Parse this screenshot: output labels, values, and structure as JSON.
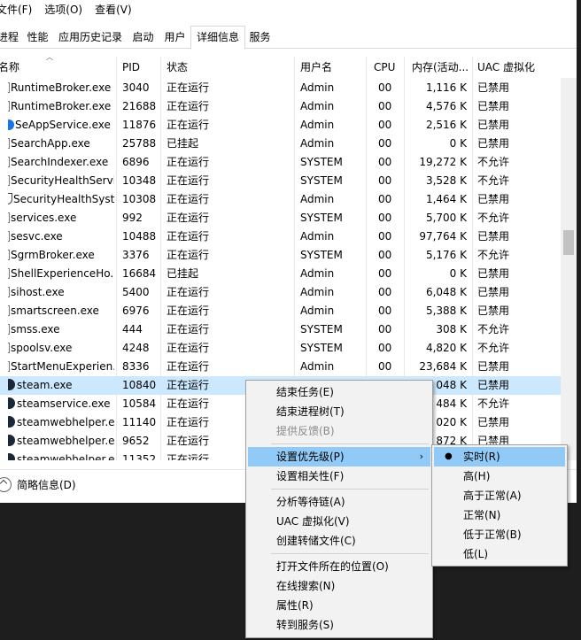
{
  "menubar": [
    "文件(F)",
    "选项(O)",
    "查看(V)"
  ],
  "tabs": [
    {
      "label": "进程",
      "active": false
    },
    {
      "label": "性能",
      "active": false
    },
    {
      "label": "应用历史记录",
      "active": false
    },
    {
      "label": "启动",
      "active": false
    },
    {
      "label": "用户",
      "active": false
    },
    {
      "label": "详细信息",
      "active": true
    },
    {
      "label": "服务",
      "active": false
    }
  ],
  "columns": [
    "名称",
    "PID",
    "状态",
    "用户名",
    "CPU",
    "内存(活动...",
    "UAC 虚拟化"
  ],
  "rows": [
    {
      "name": "RuntimeBroker.exe",
      "pid": "3040",
      "status": "正在运行",
      "user": "Admin",
      "cpu": "00",
      "mem": "1,116 K",
      "uac": "已禁用",
      "icon": "doc"
    },
    {
      "name": "RuntimeBroker.exe",
      "pid": "21688",
      "status": "正在运行",
      "user": "Admin",
      "cpu": "00",
      "mem": "4,576 K",
      "uac": "已禁用",
      "icon": "doc"
    },
    {
      "name": "SeAppService.exe",
      "pid": "11876",
      "status": "正在运行",
      "user": "Admin",
      "cpu": "00",
      "mem": "2,516 K",
      "uac": "已禁用",
      "icon": "blue"
    },
    {
      "name": "SearchApp.exe",
      "pid": "25788",
      "status": "已挂起",
      "user": "Admin",
      "cpu": "00",
      "mem": "0 K",
      "uac": "已禁用",
      "icon": "doc"
    },
    {
      "name": "SearchIndexer.exe",
      "pid": "6896",
      "status": "正在运行",
      "user": "SYSTEM",
      "cpu": "00",
      "mem": "19,272 K",
      "uac": "不允许",
      "icon": "doc"
    },
    {
      "name": "SecurityHealthServi...",
      "pid": "10348",
      "status": "正在运行",
      "user": "SYSTEM",
      "cpu": "00",
      "mem": "3,528 K",
      "uac": "不允许",
      "icon": "doc"
    },
    {
      "name": "SecurityHealthSystr...",
      "pid": "10308",
      "status": "正在运行",
      "user": "Admin",
      "cpu": "00",
      "mem": "1,464 K",
      "uac": "已禁用",
      "icon": "shield"
    },
    {
      "name": "services.exe",
      "pid": "992",
      "status": "正在运行",
      "user": "SYSTEM",
      "cpu": "00",
      "mem": "5,700 K",
      "uac": "不允许",
      "icon": "doc"
    },
    {
      "name": "sesvc.exe",
      "pid": "10488",
      "status": "正在运行",
      "user": "Admin",
      "cpu": "00",
      "mem": "97,764 K",
      "uac": "已禁用",
      "icon": "doc"
    },
    {
      "name": "SgrmBroker.exe",
      "pid": "3376",
      "status": "正在运行",
      "user": "SYSTEM",
      "cpu": "00",
      "mem": "5,176 K",
      "uac": "不允许",
      "icon": "doc"
    },
    {
      "name": "ShellExperienceHo...",
      "pid": "16684",
      "status": "已挂起",
      "user": "Admin",
      "cpu": "00",
      "mem": "0 K",
      "uac": "已禁用",
      "icon": "doc"
    },
    {
      "name": "sihost.exe",
      "pid": "5400",
      "status": "正在运行",
      "user": "Admin",
      "cpu": "00",
      "mem": "6,048 K",
      "uac": "已禁用",
      "icon": "doc"
    },
    {
      "name": "smartscreen.exe",
      "pid": "6976",
      "status": "正在运行",
      "user": "Admin",
      "cpu": "00",
      "mem": "5,388 K",
      "uac": "已禁用",
      "icon": "doc"
    },
    {
      "name": "smss.exe",
      "pid": "444",
      "status": "正在运行",
      "user": "SYSTEM",
      "cpu": "00",
      "mem": "308 K",
      "uac": "不允许",
      "icon": "doc"
    },
    {
      "name": "spoolsv.exe",
      "pid": "4248",
      "status": "正在运行",
      "user": "SYSTEM",
      "cpu": "00",
      "mem": "4,820 K",
      "uac": "不允许",
      "icon": "doc"
    },
    {
      "name": "StartMenuExperien...",
      "pid": "8336",
      "status": "正在运行",
      "user": "Admin",
      "cpu": "00",
      "mem": "23,684 K",
      "uac": "已禁用",
      "icon": "doc"
    },
    {
      "name": "steam.exe",
      "pid": "10840",
      "status": "正在运行",
      "user": "",
      "cpu": "",
      "mem": "048 K",
      "uac": "已禁用",
      "icon": "steam",
      "selected": true
    },
    {
      "name": "steamservice.exe",
      "pid": "10584",
      "status": "正在运行",
      "user": "",
      "cpu": "",
      "mem": "484 K",
      "uac": "不允许",
      "icon": "steam"
    },
    {
      "name": "steamwebhelper.exe",
      "pid": "11140",
      "status": "正在运行",
      "user": "",
      "cpu": "",
      "mem": "020 K",
      "uac": "已禁用",
      "icon": "steam"
    },
    {
      "name": "steamwebhelper.exe",
      "pid": "9652",
      "status": "正在运行",
      "user": "",
      "cpu": "",
      "mem": "872 K",
      "uac": "已禁用",
      "icon": "steam"
    },
    {
      "name": "steamwebhelper.exe",
      "pid": "11352",
      "status": "正在运行",
      "user": "",
      "cpu": "",
      "mem": "",
      "uac": "",
      "icon": "steam"
    }
  ],
  "footer": {
    "label": "简略信息(D)"
  },
  "context_menu": [
    {
      "label": "结束任务(E)"
    },
    {
      "label": "结束进程树(T)"
    },
    {
      "label": "提供反馈(B)",
      "disabled": true
    },
    {
      "separator": true
    },
    {
      "label": "设置优先级(P)",
      "submenu": true,
      "highlighted": true
    },
    {
      "label": "设置相关性(F)"
    },
    {
      "separator": true
    },
    {
      "label": "分析等待链(A)"
    },
    {
      "label": "UAC 虚拟化(V)"
    },
    {
      "label": "创建转储文件(C)"
    },
    {
      "separator": true
    },
    {
      "label": "打开文件所在的位置(O)"
    },
    {
      "label": "在线搜索(N)"
    },
    {
      "label": "属性(R)"
    },
    {
      "label": "转到服务(S)"
    }
  ],
  "priority_submenu": [
    {
      "label": "实时(R)",
      "checked": true
    },
    {
      "label": "高(H)"
    },
    {
      "label": "高于正常(A)"
    },
    {
      "label": "正常(N)"
    },
    {
      "label": "低于正常(B)"
    },
    {
      "label": "低(L)"
    }
  ]
}
